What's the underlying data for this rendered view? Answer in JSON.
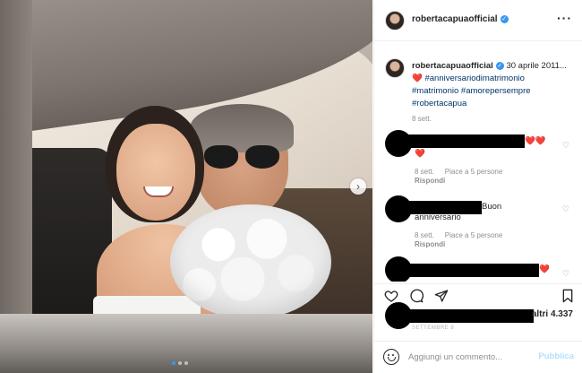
{
  "post": {
    "username": "robertacapuaofficial",
    "caption_rest": "30 aprile 2011...",
    "caption_heart": "❤️",
    "hashtags": [
      "#anniversariodimatrimonio",
      "#matrimonio",
      "#amorepersempre",
      "#robertacapua"
    ],
    "time": "8 sett."
  },
  "comments": [
    {
      "text": "",
      "emoji": "❤️❤️",
      "emoji2": "❤️",
      "time": "8 sett.",
      "likes": "Piace a 5 persone",
      "reply": "Rispondi"
    },
    {
      "text_end": "Buon",
      "text_line2": "anniversario",
      "time": "8 sett.",
      "likes": "Piace a 5 persone",
      "reply": "Rispondi"
    },
    {
      "emoji": "❤️"
    }
  ],
  "likes": {
    "others": "altri 4.337",
    "date_small": "SETTEMBRE 8"
  },
  "add_comment": {
    "placeholder": "Aggiungi un commento...",
    "publish": "Pubblica"
  },
  "colors": {
    "verified": "#3897f0",
    "hashtag": "#003569",
    "publish": "#b2dffc",
    "heart": "#e0203b"
  }
}
